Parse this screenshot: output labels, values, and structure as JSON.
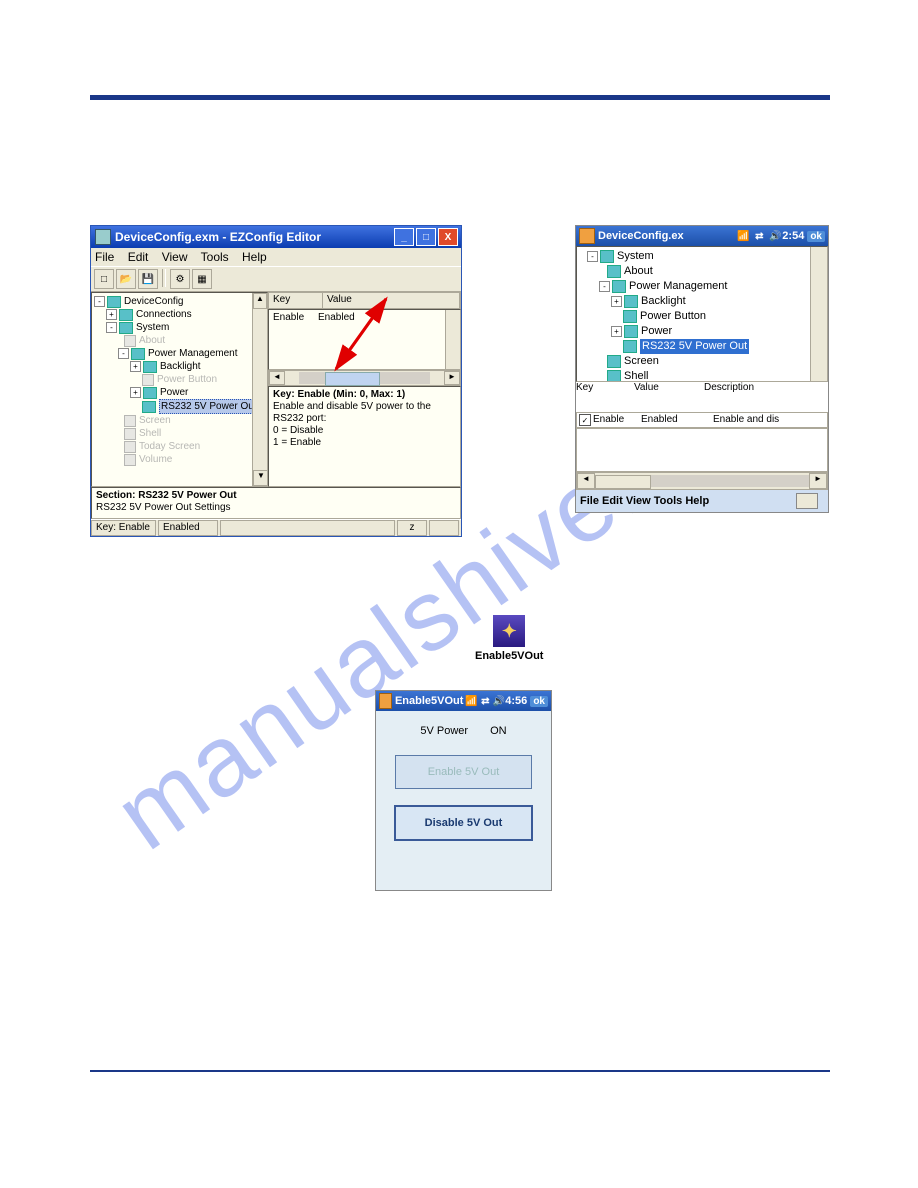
{
  "watermark": "manualshive.com",
  "ezconfig": {
    "title": "DeviceConfig.exm - EZConfig Editor",
    "menus": [
      "File",
      "Edit",
      "View",
      "Tools",
      "Help"
    ],
    "tree": {
      "root": "DeviceConfig",
      "n1": "Connections",
      "n2": "System",
      "n2a": "About",
      "n2b": "Power Management",
      "n2b1": "Backlight",
      "n2b2": "Power Button",
      "n2b3": "Power",
      "n2b4": "RS232 5V Power Out",
      "n2c": "Screen",
      "n2d": "Shell",
      "n2e": "Today Screen",
      "n2f": "Volume"
    },
    "kv": {
      "header_key": "Key",
      "header_val": "Value",
      "row_key": "Enable",
      "row_val": "Enabled"
    },
    "desc": {
      "title": "Key: Enable (Min: 0, Max: 1)",
      "l1": "Enable and disable 5V power to the RS232 port:",
      "l2": "0 = Disable",
      "l3": "1 = Enable"
    },
    "section": {
      "title": "Section: RS232 5V Power Out",
      "sub": "RS232 5V Power Out Settings"
    },
    "status": {
      "s1": "Key: Enable",
      "s2": "Enabled",
      "s3": "z"
    }
  },
  "mobile_device": {
    "title": "DeviceConfig.ex",
    "time": "2:54",
    "ok": "ok",
    "tree": {
      "sys": "System",
      "about": "About",
      "pm": "Power Management",
      "bl": "Backlight",
      "pb": "Power Button",
      "pw": "Power",
      "rs": "RS232 5V Power Out",
      "scr": "Screen",
      "shl": "Shell"
    },
    "kv": {
      "h_key": "Key",
      "h_val": "Value",
      "h_desc": "Description",
      "r_key": "Enable",
      "r_val": "Enabled",
      "r_desc": "Enable and dis"
    },
    "menus": "File Edit View Tools Help"
  },
  "app_icon": {
    "label": "Enable5VOut"
  },
  "mobile_5v": {
    "title": "Enable5VOut",
    "time": "4:56",
    "ok": "ok",
    "lbl_power": "5V Power",
    "lbl_state": "ON",
    "btn_enable": "Enable 5V Out",
    "btn_disable": "Disable 5V Out"
  }
}
